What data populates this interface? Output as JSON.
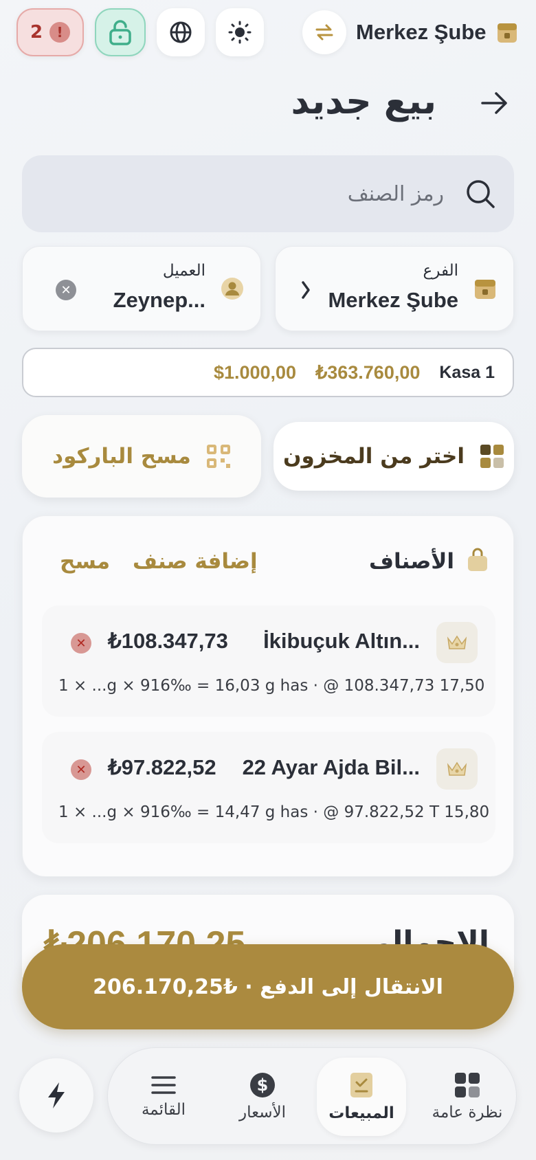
{
  "top_bar": {
    "alert_count": "2",
    "alert_mark": "!",
    "branch_name": "Merkez Şube"
  },
  "header": {
    "title": "بيع جديد"
  },
  "search": {
    "placeholder": "رمز الصنف"
  },
  "branch_selector": {
    "label": "الفرع",
    "value": "Merkez Şube"
  },
  "customer_selector": {
    "label": "العميل",
    "value": "Zeynep..."
  },
  "kasa": {
    "name": "Kasa 1",
    "amount_try": "₺363.760,00",
    "amount_usd": "$1.000,00"
  },
  "actions": {
    "stock_label": "اختر من المخزون",
    "scan_label": "مسح الباركود"
  },
  "items_section": {
    "title": "الأصناف",
    "add_label": "إضافة صنف",
    "clear_label": "مسح",
    "items": [
      {
        "name": "İkibuçuk Altın...",
        "price": "₺108.347,73",
        "meta": "1 × ...g × 916‰ = 16,03 g has · @ 108.347,73  17,50"
      },
      {
        "name": "22 Ayar Ajda Bil...",
        "price": "₺97.822,52",
        "meta": "1 × ...g × 916‰ = 14,47 g has · @ 97.822,52 T 15,80"
      }
    ]
  },
  "total": {
    "label": "الإجمالي",
    "value": "₺206.170,25"
  },
  "pay_button": {
    "label": "الانتقال إلى الدفع · ₺206.170,25"
  },
  "nav": {
    "items": [
      {
        "label": "نظرة عامة",
        "icon": "grid-icon"
      },
      {
        "label": "المبيعات",
        "icon": "receipt-icon"
      },
      {
        "label": "الأسعار",
        "icon": "dollar-icon"
      },
      {
        "label": "القائمة",
        "icon": "menu-icon"
      }
    ],
    "active": "المبيعات"
  },
  "colors": {
    "accent_gold": "#ab8a3f",
    "text_dark": "#2b2f38",
    "alert_red": "#a8332d",
    "lock_green": "#3fae8a"
  }
}
